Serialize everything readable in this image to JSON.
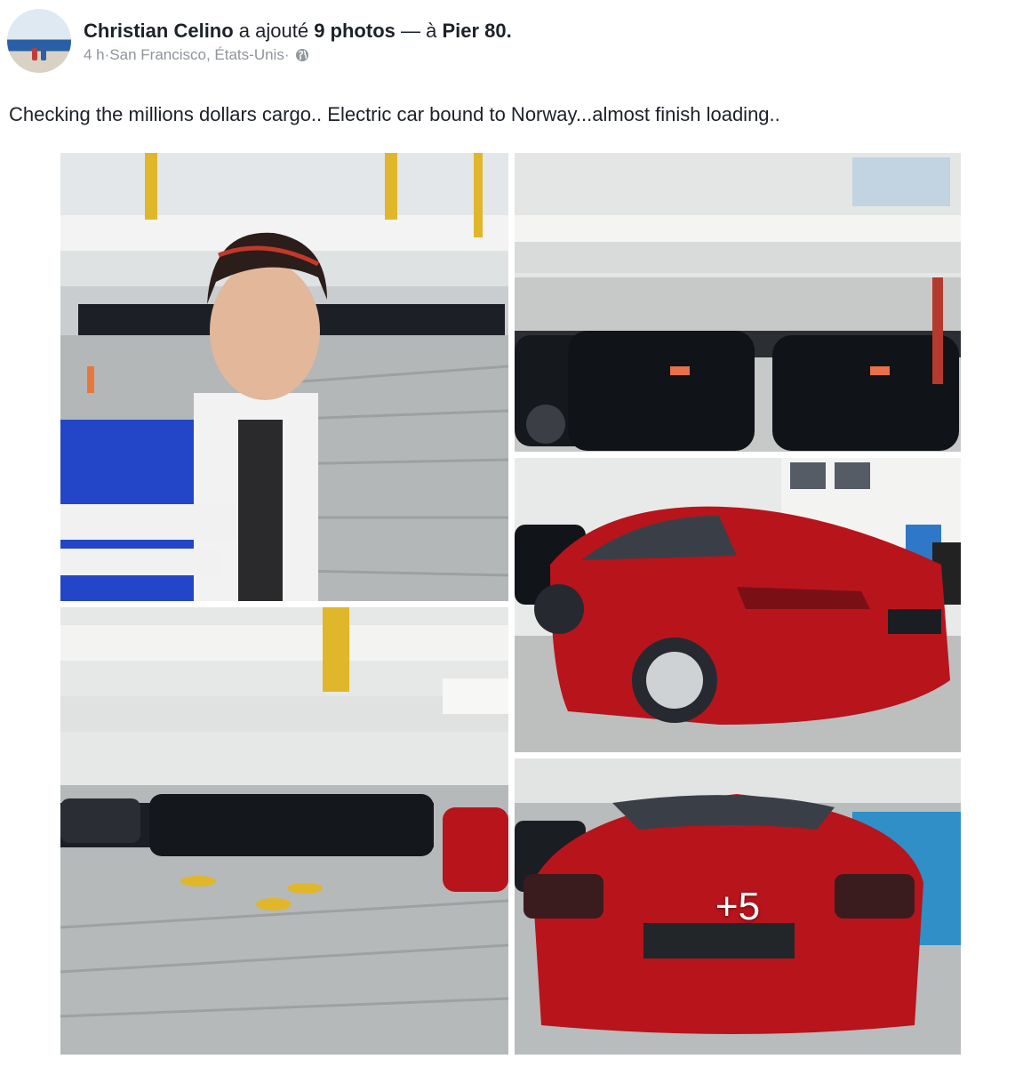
{
  "post": {
    "author": "Christian Celino",
    "action": " a ajouté ",
    "photo_count_label": "9 photos",
    "separator": " — à ",
    "place": "Pier 80.",
    "time": "4 h",
    "dot": " · ",
    "location": "San Francisco, États-Unis",
    "dot2": " · ",
    "privacy_icon": "globe-icon",
    "caption": "Checking the millions dollars cargo.. Electric car bound to Norway...almost finish loading.."
  },
  "gallery": {
    "photos": [
      "selfie-in-cargo-hold",
      "black-cars-in-ship-deck",
      "red-car-rear-quarter",
      "rows-of-cars-on-deck",
      "red-car-rear"
    ],
    "more_count": "+5"
  },
  "colors": {
    "text": "#1d2129",
    "meta": "#90949c",
    "car_red": "#b8141c",
    "deck": "#b9bcbe"
  }
}
